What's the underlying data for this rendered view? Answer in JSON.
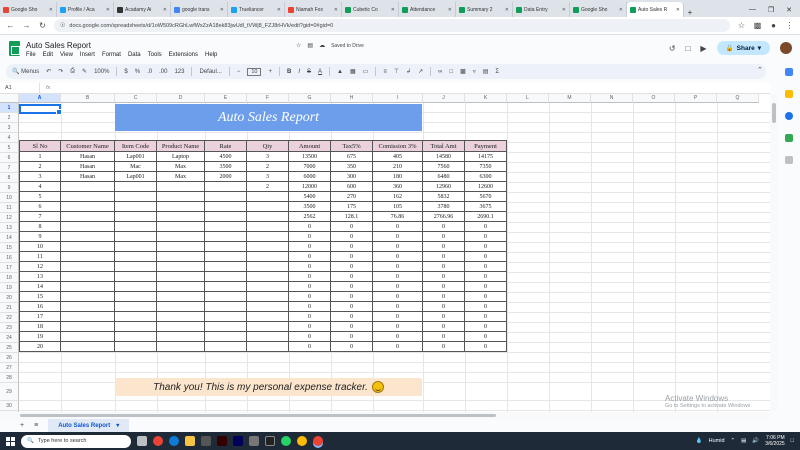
{
  "browser": {
    "tabs": [
      {
        "label": "Google Sho",
        "color": "#ea4335"
      },
      {
        "label": "Profile / Aca",
        "color": "#1da1f2"
      },
      {
        "label": "Acadamy Ai",
        "color": "#333333"
      },
      {
        "label": "google trans",
        "color": "#4285f4"
      },
      {
        "label": "Trueliancer",
        "color": "#1da1f2"
      },
      {
        "label": "Niamah Fox",
        "color": "#ea4335"
      },
      {
        "label": "Cubetic Co",
        "color": "#0f9d58"
      },
      {
        "label": "Attendance",
        "color": "#0f9d58"
      },
      {
        "label": "Summary 2",
        "color": "#0f9d58"
      },
      {
        "label": "Data Entry",
        "color": "#0f9d58"
      },
      {
        "label": "Google Sho",
        "color": "#0f9d58"
      },
      {
        "label": "Auto Sales R",
        "color": "#0f9d58",
        "active": true
      }
    ],
    "url": "docs.google.com/spreadsheets/d/1oW509cRGhLwfWxZzA18ek83jwUdl_tVWj8_FZJ8rHVk/edit?gid=0#gid=0"
  },
  "sheet": {
    "doc_title": "Auto Sales Report",
    "saved_status": "Saved to Drive",
    "menus": [
      "File",
      "Edit",
      "View",
      "Insert",
      "Format",
      "Data",
      "Tools",
      "Extensions",
      "Help"
    ],
    "share_label": "Share",
    "toolbar": {
      "menus_label": "Menus",
      "zoom": "100%",
      "currency": "$",
      "percent": "%",
      "dec_less": ".0",
      "dec_more": ".00",
      "number_format": "123",
      "font": "Defaul...",
      "font_size": "10"
    },
    "name_box": "A1",
    "fx": "fx",
    "columns": [
      "A",
      "B",
      "C",
      "D",
      "E",
      "F",
      "G",
      "H",
      "I",
      "J",
      "K",
      "L",
      "M",
      "N",
      "O",
      "P",
      "Q"
    ],
    "row_count": 31,
    "selected_cell": "A1",
    "banner_title": "Auto Sales Report",
    "footer_note": "Thank you! This is my personal expense tracker.",
    "tab_name": "Auto Sales Report",
    "watermark": {
      "line1": "Activate Windows",
      "line2": "Go to Settings to activate Windows."
    }
  },
  "report": {
    "headers": [
      "Sl No",
      "Customer Name",
      "Item Code",
      "Product Name",
      "Rate",
      "Qty",
      "Amount",
      "Tax5%",
      "Comission 3%",
      "Total Amt",
      "Payment"
    ],
    "rows": [
      [
        "1",
        "Hasan",
        "Lap001",
        "Laptop",
        "4500",
        "3",
        "13500",
        "675",
        "405",
        "14580",
        "14175"
      ],
      [
        "2",
        "Hasan",
        "Mac",
        "Max",
        "3500",
        "2",
        "7000",
        "350",
        "210",
        "7560",
        "7350"
      ],
      [
        "3",
        "Hasan",
        "Lap001",
        "Max",
        "2000",
        "3",
        "6000",
        "300",
        "180",
        "6480",
        "6300"
      ],
      [
        "4",
        "",
        "",
        "",
        "",
        "2",
        "12000",
        "600",
        "360",
        "12960",
        "12600"
      ],
      [
        "5",
        "",
        "",
        "",
        "",
        "",
        "5400",
        "270",
        "162",
        "5832",
        "5670"
      ],
      [
        "6",
        "",
        "",
        "",
        "",
        "",
        "3500",
        "175",
        "105",
        "3780",
        "3675"
      ],
      [
        "7",
        "",
        "",
        "",
        "",
        "",
        "2562",
        "128.1",
        "76.86",
        "2766.96",
        "2690.1"
      ],
      [
        "8",
        "",
        "",
        "",
        "",
        "",
        "0",
        "0",
        "0",
        "0",
        "0"
      ],
      [
        "9",
        "",
        "",
        "",
        "",
        "",
        "0",
        "0",
        "0",
        "0",
        "0"
      ],
      [
        "10",
        "",
        "",
        "",
        "",
        "",
        "0",
        "0",
        "0",
        "0",
        "0"
      ],
      [
        "11",
        "",
        "",
        "",
        "",
        "",
        "0",
        "0",
        "0",
        "0",
        "0"
      ],
      [
        "12",
        "",
        "",
        "",
        "",
        "",
        "0",
        "0",
        "0",
        "0",
        "0"
      ],
      [
        "13",
        "",
        "",
        "",
        "",
        "",
        "0",
        "0",
        "0",
        "0",
        "0"
      ],
      [
        "14",
        "",
        "",
        "",
        "",
        "",
        "0",
        "0",
        "0",
        "0",
        "0"
      ],
      [
        "15",
        "",
        "",
        "",
        "",
        "",
        "0",
        "0",
        "0",
        "0",
        "0"
      ],
      [
        "16",
        "",
        "",
        "",
        "",
        "",
        "0",
        "0",
        "0",
        "0",
        "0"
      ],
      [
        "17",
        "",
        "",
        "",
        "",
        "",
        "0",
        "0",
        "0",
        "0",
        "0"
      ],
      [
        "18",
        "",
        "",
        "",
        "",
        "",
        "0",
        "0",
        "0",
        "0",
        "0"
      ],
      [
        "19",
        "",
        "",
        "",
        "",
        "",
        "0",
        "0",
        "0",
        "0",
        "0"
      ],
      [
        "20",
        "",
        "",
        "",
        "",
        "",
        "0",
        "0",
        "0",
        "0",
        "0"
      ]
    ]
  },
  "taskbar": {
    "search_placeholder": "Type here to search",
    "weather": "Humid",
    "time": "7:06 PM",
    "date": "3/6/2025"
  }
}
